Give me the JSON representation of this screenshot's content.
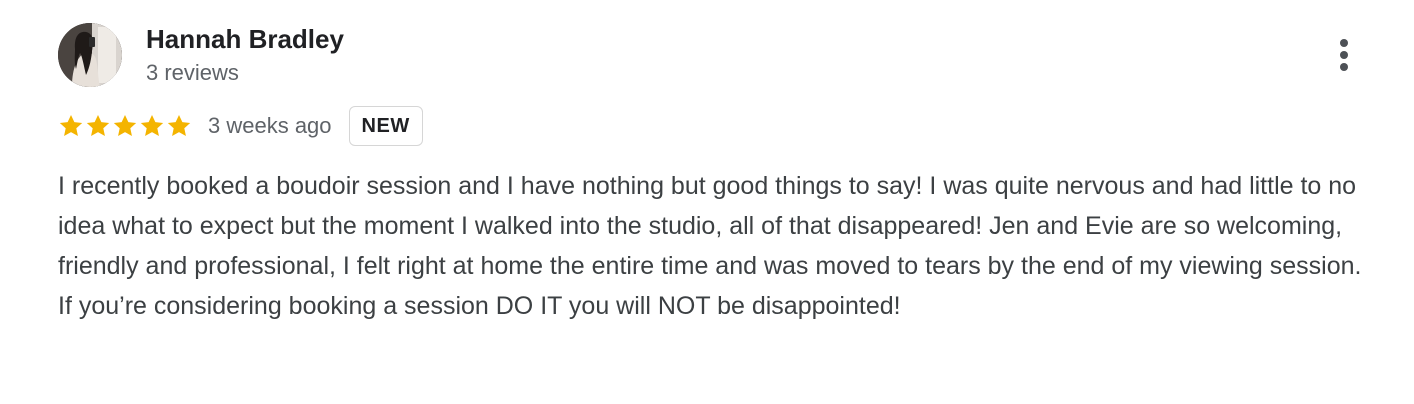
{
  "author": {
    "name": "Hannah Bradley",
    "review_count": "3 reviews",
    "avatar_icon": "user-photo"
  },
  "rating": {
    "stars": 5,
    "max_stars": 5,
    "star_color": "#f4b400"
  },
  "date": "3 weeks ago",
  "badge": "NEW",
  "menu_icon": "more-vert-icon",
  "text": "I recently booked a boudoir session and I have nothing but good things to say! I was quite nervous and had little to no idea what to expect but the moment I walked into the studio, all of that disappeared! Jen and Evie are so welcoming, friendly and professional, I felt right at home the entire time and was moved to tears by the end of my viewing session. If you’re considering booking a session DO IT you will NOT be disappointed!"
}
